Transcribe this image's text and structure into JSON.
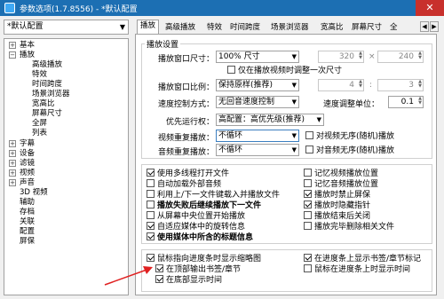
{
  "window": {
    "title": "参数选项(1.7.8556) - *默认配置",
    "close": "✕"
  },
  "profile": {
    "value": "*默认配置"
  },
  "tree": {
    "nodes": [
      {
        "label": "基本",
        "expander": "+"
      },
      {
        "label": "播放",
        "expander": "−"
      },
      {
        "label": "高级播放"
      },
      {
        "label": "特效"
      },
      {
        "label": "时间跨度"
      },
      {
        "label": "场景浏览器"
      },
      {
        "label": "宽高比"
      },
      {
        "label": "屏幕尺寸"
      },
      {
        "label": "全屏"
      },
      {
        "label": "列表"
      },
      {
        "label": "字幕",
        "expander": "+"
      },
      {
        "label": "设备",
        "expander": "+"
      },
      {
        "label": "滤镜",
        "expander": "+"
      },
      {
        "label": "视频",
        "expander": "+"
      },
      {
        "label": "声音",
        "expander": "+"
      },
      {
        "label": "3D 视频"
      },
      {
        "label": "辅助"
      },
      {
        "label": "存档"
      },
      {
        "label": "关联"
      },
      {
        "label": "配置"
      },
      {
        "label": "屏保"
      }
    ]
  },
  "tabs": [
    "播放",
    "高级播放",
    "特效",
    "时间跨度",
    "场景浏览器",
    "宽高比",
    "屏幕尺寸",
    "全"
  ],
  "tab_scroll": {
    "left": "◀",
    "right": "▶"
  },
  "settings": {
    "group_title": "播放设置",
    "window_size_label": "播放窗口尺寸：",
    "window_size_value": "100% 尺寸",
    "width_value": "320",
    "times": "×",
    "height_value": "240",
    "resize_once_label": "仅在播放视频时调整一次尺寸",
    "aspect_label": "播放窗口比例：",
    "aspect_value": "保持原样(推荐)",
    "ratio_a": "4",
    "colon": ":",
    "ratio_b": "3",
    "speed_mode_label": "速度控制方式：",
    "speed_mode_value": "无回音速度控制",
    "speed_unit_label": "速度调整单位：",
    "speed_unit_value": "0.1",
    "priority_label": "优先运行权：",
    "priority_value": "高配置：高优先级(推荐)",
    "video_repeat_label": "视频重复播放：",
    "video_repeat_value": "不循环",
    "video_shuffle_label": "对视频无序(随机)播放",
    "audio_repeat_label": "音频重复播放：",
    "audio_repeat_value": "不循环",
    "audio_shuffle_label": "对音频无序(随机)播放"
  },
  "checks_left": [
    {
      "label": "使用多线程打开文件",
      "checked": true
    },
    {
      "label": "自动加载外部音频",
      "checked": false
    },
    {
      "label": "利用上/下一文件键载入并播放文件",
      "checked": false
    },
    {
      "label": "播放失败后继续播放下一文件",
      "checked": false,
      "bold": true
    },
    {
      "label": "从屏幕中央位置开始播放",
      "checked": false
    },
    {
      "label": "自适应媒体中的旋转信息",
      "checked": true
    },
    {
      "label": "使用媒体中所含的标题信息",
      "checked": true,
      "bold": true
    }
  ],
  "checks_right": [
    {
      "label": "记忆视频播放位置",
      "checked": false
    },
    {
      "label": "记忆音频播放位置",
      "checked": false
    },
    {
      "label": "播放时禁止屏保",
      "checked": true
    },
    {
      "label": "播放时隐藏指针",
      "checked": true
    },
    {
      "label": "播放结束后关闭",
      "checked": false
    },
    {
      "label": "播放完毕删除相关文件",
      "checked": false
    }
  ],
  "bottom_left": [
    {
      "label": "鼠标指向进度条时显示缩略图",
      "checked": true
    },
    {
      "label": "在顶部输出书签/章节",
      "checked": true
    },
    {
      "label": "在底部显示时间",
      "checked": true
    }
  ],
  "bottom_right": [
    {
      "label": "在进度条上显示书签/章节标记",
      "checked": true
    },
    {
      "label": "鼠标在进度条上时显示时间",
      "checked": false
    }
  ],
  "colors": {
    "titlebar": "#1c6fb3",
    "annotation": "#e02020"
  }
}
